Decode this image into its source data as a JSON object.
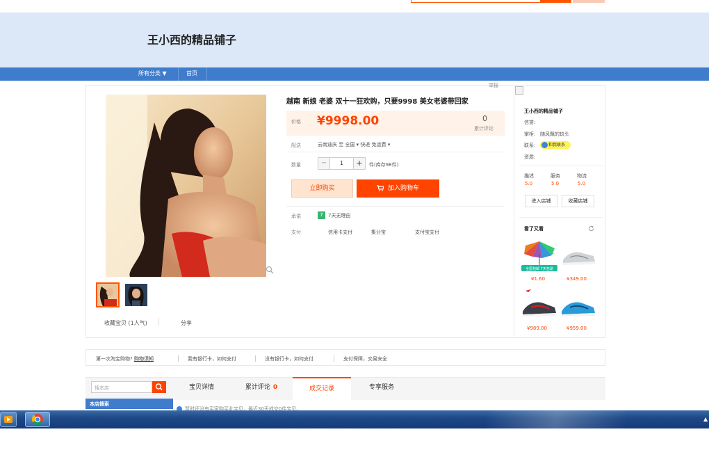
{
  "shop": {
    "name": "王小西的精品铺子"
  },
  "nav": {
    "all_categories": "所有分类 ▼",
    "home": "首页"
  },
  "product": {
    "title": "越南 新娘 老婆 双十一狂欢购，只要9998 美女老婆带回家",
    "report_label": "举报",
    "price_label": "价格",
    "price": "¥9998.00",
    "review_count": "0",
    "review_label": "累计评论",
    "delivery_label": "配送",
    "delivery_text": "云南迪庆 至 全国 ▾ 快递 免运费 ▾",
    "quantity_label": "数量",
    "quantity": "1",
    "stock_text": "件(库存98件)",
    "buy_now": "立即购买",
    "add_to_cart": "加入购物车",
    "promise_label": "承诺",
    "promise_icon_text": "7",
    "promise_text": "7天无理由",
    "payment_label": "支付",
    "payment_methods": [
      "信用卡支付",
      "集分宝",
      "支付宝支付"
    ],
    "favorite_text": "收藏宝贝 (1人气)",
    "share_text": "分享"
  },
  "seller": {
    "shop_name": "王小西的精品铺子",
    "reputation_label": "信誉:",
    "seller_label": "掌柜:",
    "seller_name": "随风飘的玖头",
    "contact_label": "联系:",
    "wangwang_text": "和我联系",
    "qualification_label": "资质:",
    "scores": [
      {
        "label": "描述",
        "value": "5.0"
      },
      {
        "label": "服务",
        "value": "5.0"
      },
      {
        "label": "物流",
        "value": "5.0"
      }
    ],
    "enter_shop": "进入店铺",
    "favorite_shop": "收藏店铺"
  },
  "recommend": {
    "title": "看了又看",
    "items": [
      {
        "price": "¥1.60",
        "badge": "全国包邮 7天包退"
      },
      {
        "price": "¥349.00"
      },
      {
        "price": "¥989.00"
      },
      {
        "price": "¥959.00"
      }
    ]
  },
  "notice": {
    "first_time": "第一次淘宝购物?",
    "guide_link": "购物须知",
    "items": [
      "我有银行卡，如何支付",
      "没有银行卡，如何支付",
      "支付保障，交易安全"
    ]
  },
  "tabs": {
    "search_placeholder": "搜本店",
    "items": [
      {
        "label": "宝贝详情",
        "badge": ""
      },
      {
        "label": "累计评论",
        "badge": "0"
      },
      {
        "label": "成交记录",
        "badge": ""
      },
      {
        "label": "专享服务",
        "badge": ""
      }
    ],
    "sidebar_header": "本店搜索",
    "info_text": "暂时还没有买家购买此宝贝，最近30天成交0件宝贝。"
  },
  "colors": {
    "accent": "#ff4400",
    "nav_blue": "#3f7ccc",
    "banner": "#dce8f8"
  }
}
